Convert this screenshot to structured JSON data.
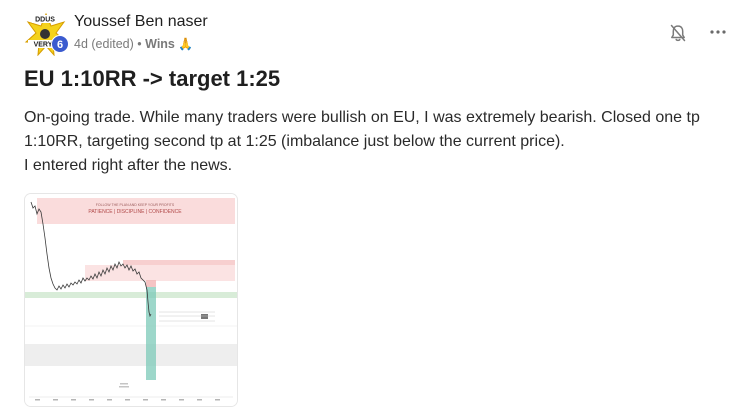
{
  "post": {
    "author": "Youssef Ben naser",
    "level": "6",
    "time": "4d (edited)",
    "separator": "•",
    "category": "Wins",
    "category_emoji": "🙏",
    "title": "EU 1:10RR -> target 1:25",
    "body_line1": "On-going trade. While many traders were bullish on EU, I was extremely bearish. Closed one tp 1:10RR, targeting second tp at 1:25 (imbalance just below the current price).",
    "body_line2": "I entered right after the news."
  },
  "icons": {
    "bell": "bell-off-icon",
    "more": "more-horizontal-icon"
  },
  "attachment": {
    "banner_small": "FOLLOW THE PLAN AND KEEP YOUR PROFITS",
    "banner_main": "PATIENCE | DISCIPLINE | CONFIDENCE"
  },
  "colors": {
    "level_badge": "#3b5bcf",
    "supply_zone": "#f9d6d6",
    "demand_zone": "#d8ecd8",
    "trade_box": "#7cc9b8"
  }
}
